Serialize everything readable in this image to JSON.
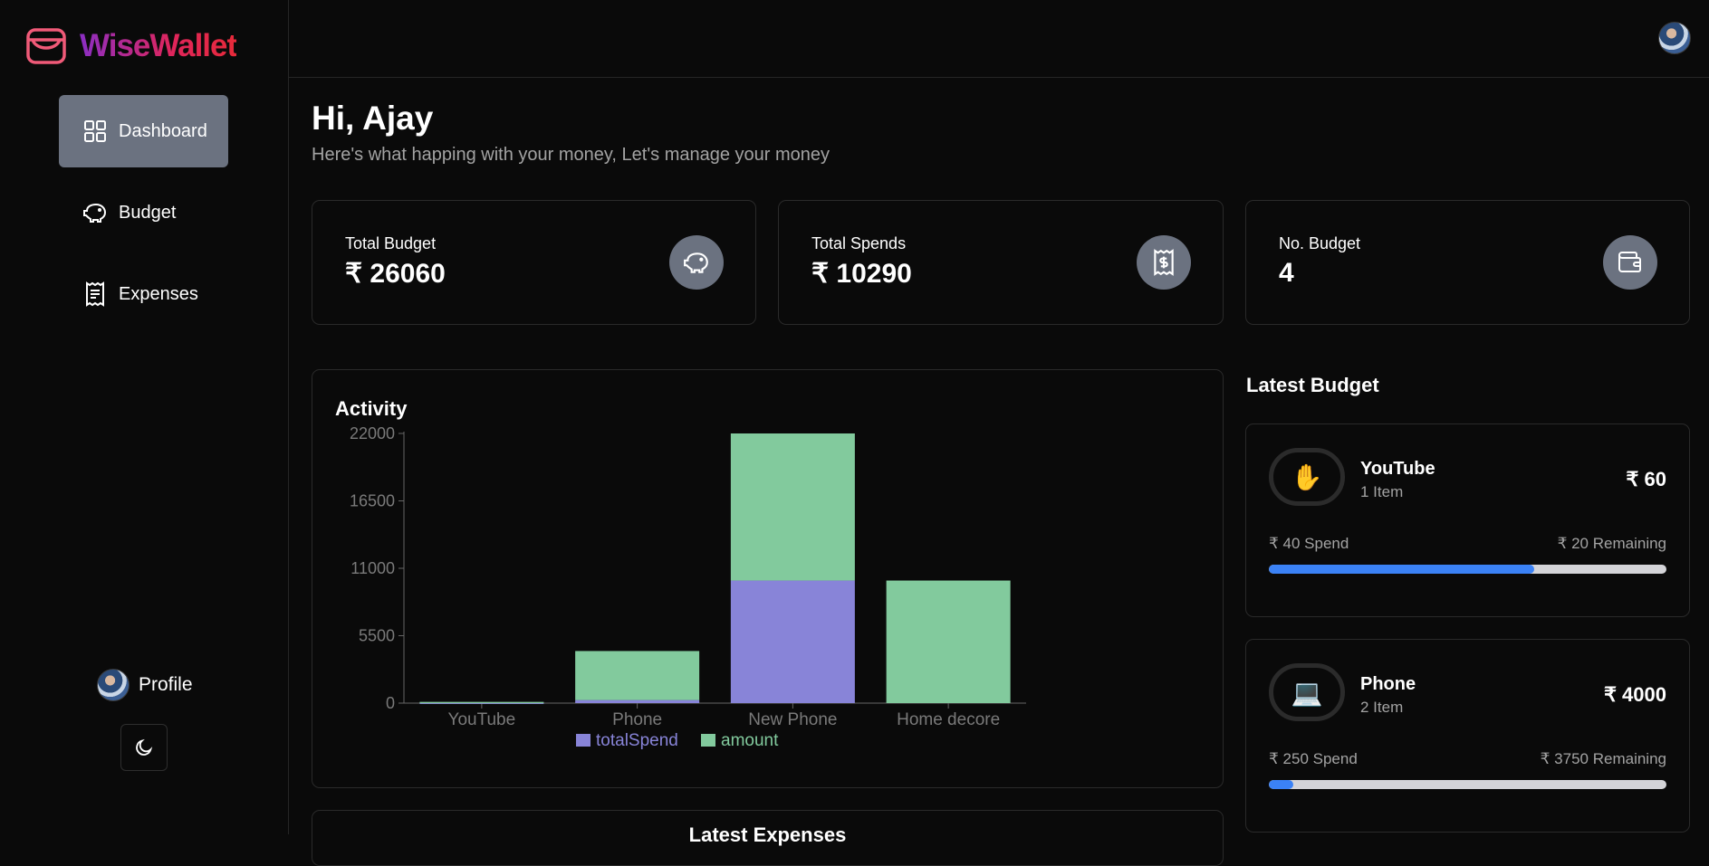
{
  "app": {
    "name": "WiseWallet"
  },
  "sidebar": {
    "items": [
      {
        "label": "Dashboard",
        "icon": "grid-icon",
        "active": true
      },
      {
        "label": "Budget",
        "icon": "piggy-bank-icon",
        "active": false
      },
      {
        "label": "Expenses",
        "icon": "receipt-icon",
        "active": false
      }
    ],
    "profile_label": "Profile",
    "theme_icon": "moon-icon"
  },
  "header": {
    "greeting": "Hi, Ajay",
    "subtitle": "Here's what happing with your money, Let's manage your money"
  },
  "stats": [
    {
      "label": "Total Budget",
      "value": "₹ 26060",
      "icon": "piggy-bank-icon"
    },
    {
      "label": "Total Spends",
      "value": "₹ 10290",
      "icon": "receipt-dollar-icon"
    },
    {
      "label": "No. Budget",
      "value": "4",
      "icon": "wallet-icon"
    }
  ],
  "activity": {
    "title": "Activity"
  },
  "chart_data": {
    "type": "bar",
    "stacked": true,
    "categories": [
      "YouTube",
      "Phone",
      "New Phone",
      "Home decore"
    ],
    "series": [
      {
        "name": "totalSpend",
        "values": [
          40,
          250,
          10000,
          0
        ],
        "color": "#8884d8"
      },
      {
        "name": "amount",
        "values": [
          60,
          4000,
          12000,
          10000
        ],
        "color": "#82ca9d"
      }
    ],
    "yticks": [
      0,
      5500,
      11000,
      16500,
      22000
    ],
    "ylim": [
      0,
      22000
    ],
    "legend": "bottom",
    "grid": false
  },
  "latest_budget": {
    "title": "Latest Budget",
    "items": [
      {
        "emoji": "✋",
        "name": "YouTube",
        "count": "1 Item",
        "amount": "₹ 60",
        "spend": "₹ 40 Spend",
        "remaining": "₹ 20 Remaining",
        "progress": 0.667
      },
      {
        "emoji": "💻",
        "name": "Phone",
        "count": "2 Item",
        "amount": "₹ 4000",
        "spend": "₹ 250 Spend",
        "remaining": "₹ 3750 Remaining",
        "progress": 0.0625
      }
    ]
  },
  "latest_expenses": {
    "title": "Latest Expenses"
  },
  "colors": {
    "accent": "#3b82f6",
    "active_nav": "#6b7280",
    "background": "#0a0a0a"
  }
}
